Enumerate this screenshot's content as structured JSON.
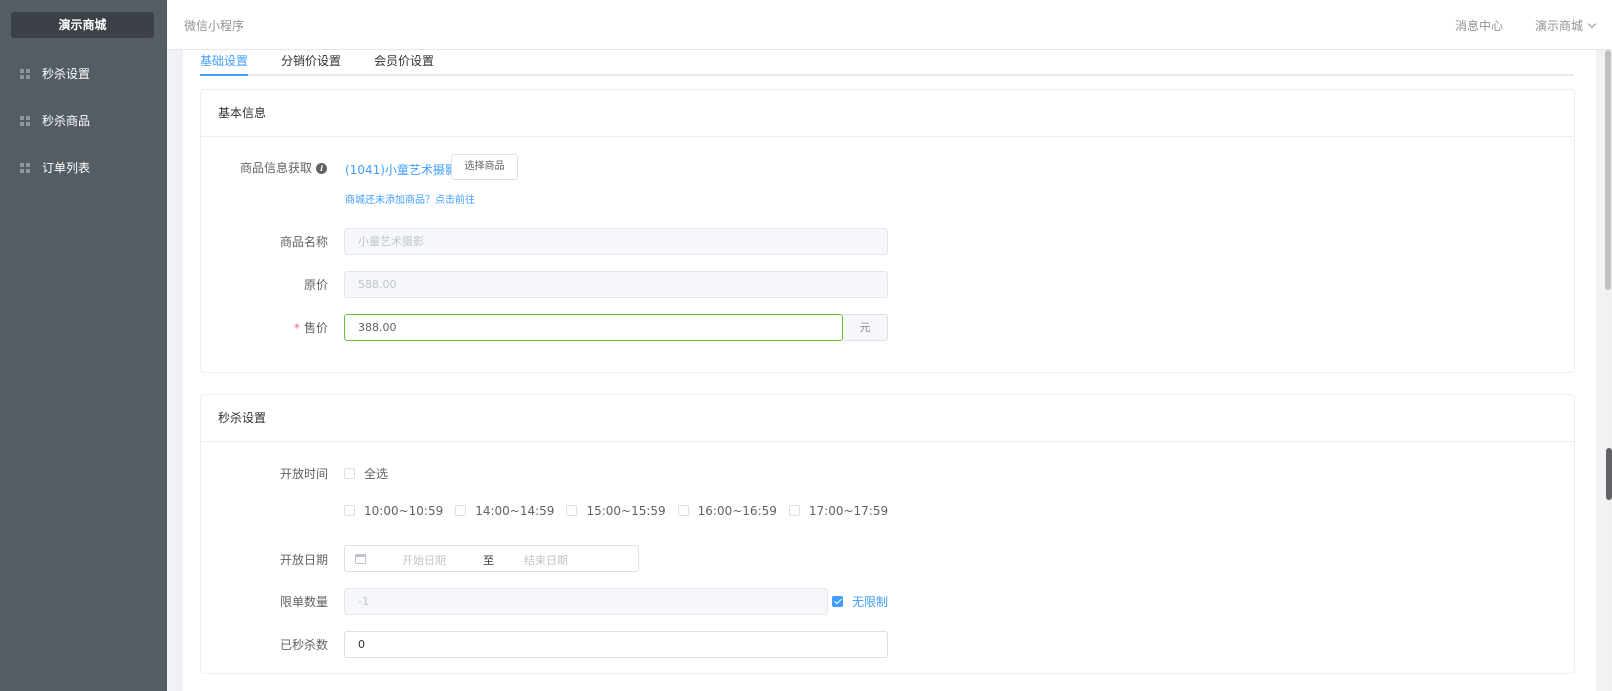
{
  "sidebar": {
    "brand": "演示商城",
    "items": [
      {
        "label": "秒杀设置"
      },
      {
        "label": "秒杀商品"
      },
      {
        "label": "订单列表"
      }
    ]
  },
  "topbar": {
    "title": "微信小程序",
    "messages": "消息中心",
    "user": "演示商城"
  },
  "tabs": [
    {
      "label": "基础设置",
      "active": true
    },
    {
      "label": "分销价设置",
      "active": false
    },
    {
      "label": "会员价设置",
      "active": false
    }
  ],
  "basic_info": {
    "header": "基本信息",
    "goods_fetch_label": "商品信息获取",
    "goods_link": "(1041)小童艺术摄影",
    "select_button": "选择商品",
    "hint_link": "商城还未添加商品？点击前往",
    "name_label": "商品名称",
    "name_value": "小童艺术摄影",
    "original_label": "原价",
    "original_value": "588.00",
    "price_label": "售价",
    "price_value": "388.00",
    "price_unit": "元"
  },
  "seckill": {
    "header": "秒杀设置",
    "open_time_label": "开放时间",
    "select_all": "全选",
    "time_slots": [
      "10:00~10:59",
      "14:00~14:59",
      "15:00~15:59",
      "16:00~16:59",
      "17:00~17:59"
    ],
    "open_date_label": "开放日期",
    "start_placeholder": "开始日期",
    "date_separator": "至",
    "end_placeholder": "结束日期",
    "limit_label": "限单数量",
    "limit_value": "-1",
    "unlimited_label": "无限制",
    "unlimited_checked": true,
    "sold_label": "已秒杀数",
    "sold_value": "0"
  },
  "colors": {
    "sidebar_bg": "#545c64",
    "accent": "#409eff",
    "focus_border": "#67c23a",
    "required": "#f56c6c"
  }
}
